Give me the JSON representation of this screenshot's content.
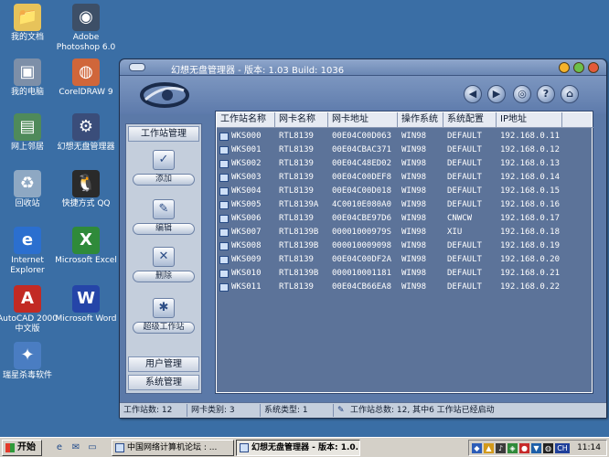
{
  "desktop": {
    "icons": [
      {
        "label": "我的文档",
        "glyph": "📁",
        "icon": "my-documents-icon"
      },
      {
        "label": "Adobe Photoshop 6.0",
        "glyph": "◉",
        "icon": "photoshop-icon"
      },
      {
        "label": "我的电脑",
        "glyph": "▣",
        "icon": "my-computer-icon"
      },
      {
        "label": "CorelDRAW 9",
        "glyph": "◍",
        "icon": "coreldraw-icon"
      },
      {
        "label": "网上邻居",
        "glyph": "▤",
        "icon": "network-icon"
      },
      {
        "label": "幻想无盘管理器",
        "glyph": "⚙",
        "icon": "diskless-manager-icon"
      },
      {
        "label": "回收站",
        "glyph": "♻",
        "icon": "recycle-bin-icon"
      },
      {
        "label": "快捷方式 QQ",
        "glyph": "🐧",
        "icon": "qq-icon"
      },
      {
        "label": "Internet Explorer",
        "glyph": "e",
        "icon": "internet-explorer-icon"
      },
      {
        "label": "Microsoft Excel",
        "glyph": "X",
        "icon": "excel-icon"
      },
      {
        "label": "AutoCAD 2000 中文版",
        "glyph": "A",
        "icon": "autocad-icon"
      },
      {
        "label": "Microsoft Word",
        "glyph": "W",
        "icon": "word-icon"
      },
      {
        "label": "瑞星杀毒软件",
        "glyph": "✦",
        "icon": "rising-antivirus-icon"
      }
    ]
  },
  "window": {
    "title": "幻想无盘管理器 - 版本: 1.03 Build: 1036",
    "toolbar_buttons": [
      {
        "icon": "back-icon",
        "glyph": "◀"
      },
      {
        "icon": "forward-icon",
        "glyph": "▶"
      },
      {
        "icon": "settings-icon",
        "glyph": "◎"
      },
      {
        "icon": "help-icon",
        "glyph": "?"
      },
      {
        "icon": "home-icon",
        "glyph": "⌂"
      }
    ]
  },
  "sidebar": {
    "workstation_section": "工作站管理",
    "tools": [
      {
        "label": "添加",
        "icon": "add-workstation-icon",
        "glyph": "✓"
      },
      {
        "label": "编辑",
        "icon": "edit-workstation-icon",
        "glyph": "✎"
      },
      {
        "label": "删除",
        "icon": "delete-workstation-icon",
        "glyph": "✕"
      },
      {
        "label": "超级工作站",
        "icon": "super-workstation-icon",
        "glyph": "✱"
      }
    ],
    "user_section": "用户管理",
    "system_section": "系统管理"
  },
  "table": {
    "columns": [
      "工作站名称",
      "网卡名称",
      "网卡地址",
      "操作系统",
      "系统配置",
      "IP地址"
    ],
    "rows": [
      [
        "WKS000",
        "RTL8139",
        "00E04C00D063",
        "WIN98",
        "DEFAULT",
        "192.168.0.11"
      ],
      [
        "WKS001",
        "RTL8139",
        "00E04CBAC371",
        "WIN98",
        "DEFAULT",
        "192.168.0.12"
      ],
      [
        "WKS002",
        "RTL8139",
        "00E04C48ED02",
        "WIN98",
        "DEFAULT",
        "192.168.0.13"
      ],
      [
        "WKS003",
        "RTL8139",
        "00E04C00DEF8",
        "WIN98",
        "DEFAULT",
        "192.168.0.14"
      ],
      [
        "WKS004",
        "RTL8139",
        "00E04C00D018",
        "WIN98",
        "DEFAULT",
        "192.168.0.15"
      ],
      [
        "WKS005",
        "RTL8139A",
        "4C0010E080A0",
        "WIN98",
        "DEFAULT",
        "192.168.0.16"
      ],
      [
        "WKS006",
        "RTL8139",
        "00E04CBE97D6",
        "WIN98",
        "CNWCW",
        "192.168.0.17"
      ],
      [
        "WKS007",
        "RTL8139B",
        "00001000979S",
        "WIN98",
        "XIU",
        "192.168.0.18"
      ],
      [
        "WKS008",
        "RTL8139B",
        "000010009098",
        "WIN98",
        "DEFAULT",
        "192.168.0.19"
      ],
      [
        "WKS009",
        "RTL8139",
        "00E04C00DF2A",
        "WIN98",
        "DEFAULT",
        "192.168.0.20"
      ],
      [
        "WKS010",
        "RTL8139B",
        "000010001181",
        "WIN98",
        "DEFAULT",
        "192.168.0.21"
      ],
      [
        "WKS011",
        "RTL8139",
        "00E04CB66EA8",
        "WIN98",
        "DEFAULT",
        "192.168.0.22"
      ]
    ]
  },
  "status": {
    "workstation_count": "工作站数: 12",
    "nic_types": "网卡类别: 3",
    "os_types": "系统类型: 1",
    "summary": "工作站总数: 12, 其中6 工作站已经启动"
  },
  "taskbar": {
    "start_label": "开始",
    "quick_launch": [
      {
        "icon": "ie-quicklaunch-icon",
        "glyph": "e"
      },
      {
        "icon": "outlook-quicklaunch-icon",
        "glyph": "✉"
      },
      {
        "icon": "show-desktop-icon",
        "glyph": "▭"
      }
    ],
    "tasks": [
      {
        "label": "中国网络计算机论坛 : ...",
        "active": false
      },
      {
        "label": "幻想无盘管理器 - 版本: 1.0...",
        "active": true
      }
    ],
    "tray_icons": [
      {
        "icon": "tray-a-icon",
        "glyph": "◆",
        "color": "#2d5db8"
      },
      {
        "icon": "tray-b-icon",
        "glyph": "▲",
        "color": "#d39a1b"
      },
      {
        "icon": "volume-icon",
        "glyph": "♪",
        "color": "#3b3b3b"
      },
      {
        "icon": "tray-c-icon",
        "glyph": "◈",
        "color": "#2f8a3a"
      },
      {
        "icon": "tray-d-icon",
        "glyph": "●",
        "color": "#c62a2a"
      },
      {
        "icon": "tray-e-icon",
        "glyph": "▼",
        "color": "#1d5fa8"
      },
      {
        "icon": "qq-tray-icon",
        "glyph": "◍",
        "color": "#222222"
      },
      {
        "icon": "input-method-icon",
        "glyph": "CH",
        "color": "#1f3f9a"
      }
    ],
    "clock": "11:14"
  }
}
